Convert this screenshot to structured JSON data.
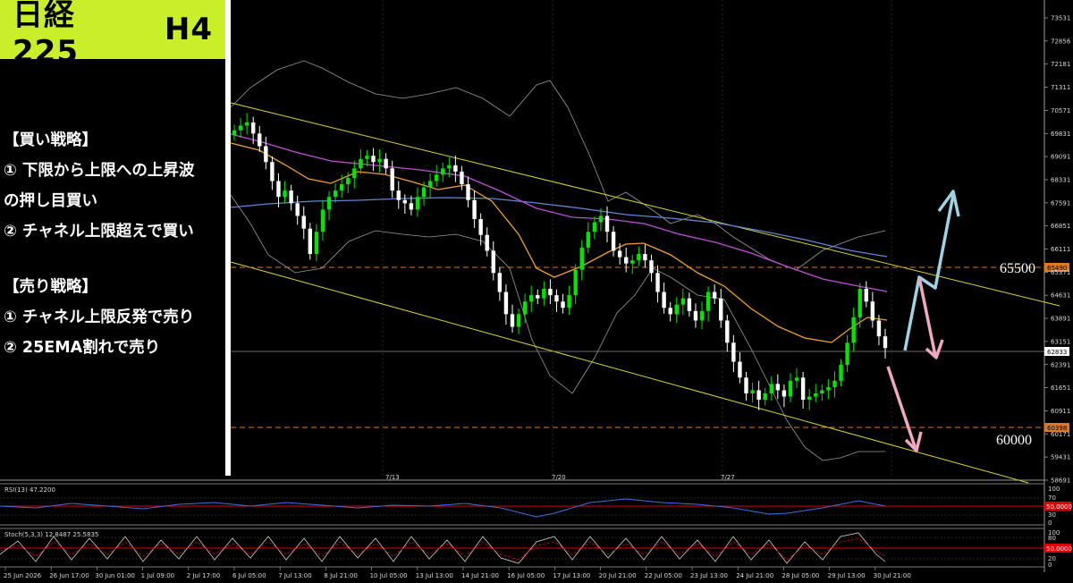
{
  "header": {
    "title_symbol": "日経225",
    "title_timeframe": "H4"
  },
  "strategy": {
    "buy_heading": "【買い戦略】",
    "buy_1": "① 下限から上限への上昇波",
    "buy_1b": "の押し目買い",
    "buy_2": "② チャネル上限超えで買い",
    "sell_heading": "【売り戦略】",
    "sell_1": "① チャネル上限反発で売り",
    "sell_2": "② 25EMA割れで売り"
  },
  "levels": {
    "upper_label": "65500",
    "lower_label": "60000",
    "upper_tag": "65490",
    "lower_tag": "60398",
    "current_tag": "62833"
  },
  "indicators": {
    "rsi_label": "RSI(13) 47.2200",
    "rsi_ticks": [
      "100",
      "70",
      "50.0000",
      "30",
      "0"
    ],
    "stoch_label": "Stoch(5,3,3) 12.8487 25.5835",
    "stoch_ticks": [
      "100",
      "80",
      "50.0000",
      "20",
      "0"
    ]
  },
  "colors": {
    "title_bg": "#c8ef27",
    "candle_up": "#00e600",
    "candle_down": "#ffffff",
    "ema_short": "#f0a030",
    "ema_mid": "#c050d8",
    "ema_long": "#5f86d8",
    "channel": "#d8d820",
    "level_line": "#e07820",
    "arrow_up": "#9cd4e4",
    "arrow_down": "#f0a8c0",
    "indicator_red": "#e00000"
  },
  "chart_data": {
    "type": "candlestick",
    "price_ticks": [
      "73531",
      "72856",
      "72181",
      "71311",
      "70571",
      "69831",
      "69091",
      "68331",
      "67591",
      "66851",
      "66111",
      "65371",
      "64631",
      "63891",
      "63151",
      "62391",
      "61651",
      "60911",
      "60171",
      "59431",
      "58691"
    ],
    "date_ticks_top": [
      "7/13",
      "7/20",
      "7/27"
    ],
    "time_labels": [
      "25 Jun 2026",
      "26 Jun 17:00",
      "30 Jun 01:00",
      "1 Jul 09:00",
      "2 Jul 17:00",
      "6 Jul 05:00",
      "7 Jul 13:00",
      "8 Jul 21:00",
      "10 Jul 05:00",
      "13 Jul 13:00",
      "14 Jul 21:00",
      "16 Jul 05:00",
      "17 Jul 13:00",
      "20 Jul 21:00",
      "22 Jul 05:00",
      "23 Jul 13:00",
      "24 Jul 21:00",
      "28 Jul 05:00",
      "29 Jul 13:00",
      "30 Jul 21:00"
    ],
    "ylim": [
      58691,
      73531
    ],
    "levels": [
      65500,
      60000
    ],
    "current_price": 62833,
    "closes": [
      69700,
      69850,
      69950,
      69600,
      69200,
      68700,
      68100,
      67600,
      67800,
      67400,
      67000,
      66600,
      65800,
      66500,
      67200,
      67600,
      67800,
      68000,
      68200,
      68500,
      68800,
      68900,
      68700,
      68800,
      68500,
      67800,
      67500,
      67400,
      67200,
      67600,
      67900,
      68100,
      68300,
      68500,
      68600,
      68400,
      68000,
      67500,
      66900,
      66400,
      65900,
      65200,
      64600,
      63900,
      63500,
      63900,
      64300,
      64500,
      64400,
      64700,
      64500,
      64300,
      64100,
      64500,
      65300,
      66000,
      66500,
      66800,
      67000,
      66500,
      65900,
      65700,
      65500,
      65600,
      65800,
      65600,
      65200,
      64600,
      64100,
      63900,
      64200,
      64400,
      64000,
      63700,
      64000,
      64600,
      64400,
      63700,
      63000,
      62400,
      61900,
      61400,
      61500,
      61200,
      61400,
      61700,
      61500,
      61300,
      61800,
      61900,
      61200,
      61300,
      61400,
      61500,
      61600,
      61800,
      62300,
      63000,
      63800,
      64700,
      64300,
      63700,
      63200,
      62833
    ]
  }
}
